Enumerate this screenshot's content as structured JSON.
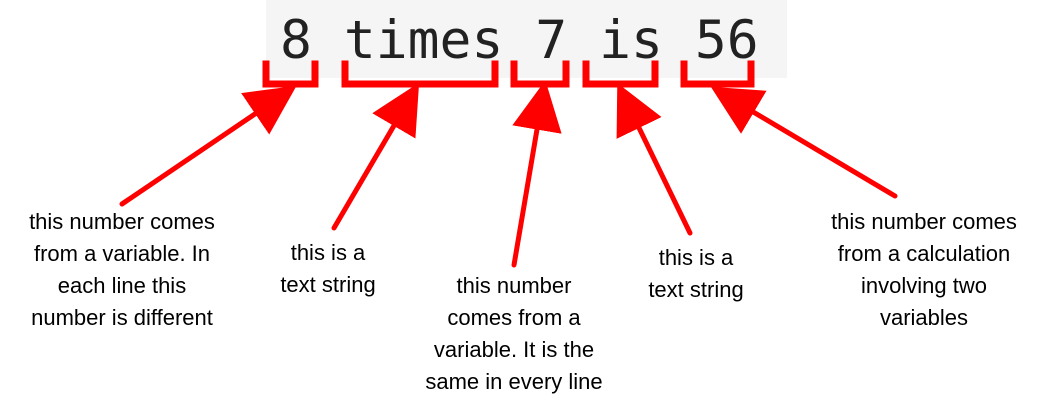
{
  "code": {
    "line": "8 times 7 is 56",
    "tokens": [
      "8",
      "times",
      "7",
      "is",
      "56"
    ]
  },
  "annotations": [
    {
      "text": "this number comes\nfrom a variable. In\neach line this\nnumber is different"
    },
    {
      "text": "this is a\ntext string"
    },
    {
      "text": "this number\ncomes from a\nvariable. It is the\nsame in every line"
    },
    {
      "text": "this is a\ntext string"
    },
    {
      "text": "this number comes\nfrom a calculation\ninvolving two\nvariables"
    }
  ],
  "colors": {
    "annotation": "#ff0000",
    "code_background": "#f5f5f5",
    "code_text": "#222222",
    "label_text": "#000000"
  },
  "icons": {
    "bracket": "red-square-bracket",
    "arrow": "red-arrow"
  }
}
